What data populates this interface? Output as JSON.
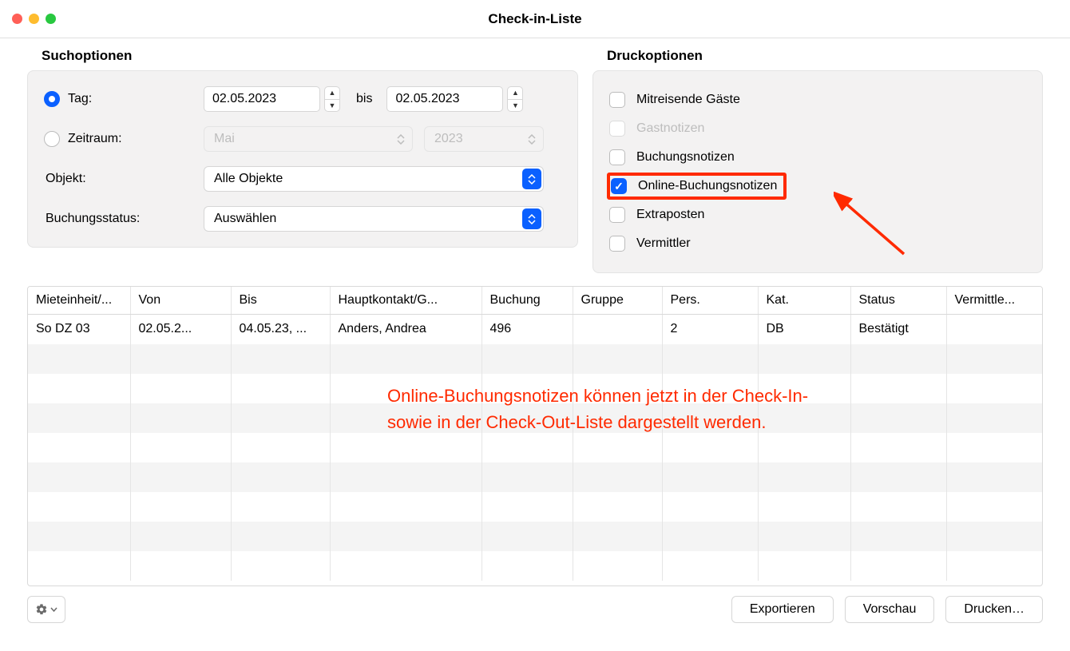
{
  "window_title": "Check-in-Liste",
  "search": {
    "section_title": "Suchoptionen",
    "tag_label": "Tag:",
    "zeitraum_label": "Zeitraum:",
    "date_from": "02.05.2023",
    "bis_label": "bis",
    "date_to": "02.05.2023",
    "month": "Mai",
    "year": "2023",
    "objekt_label": "Objekt:",
    "objekt_value": "Alle Objekte",
    "status_label": "Buchungsstatus:",
    "status_value": "Auswählen"
  },
  "print": {
    "section_title": "Druckoptionen",
    "mitreisende": "Mitreisende Gäste",
    "gastnotizen": "Gastnotizen",
    "buchungsnotizen": "Buchungsnotizen",
    "online_buchungsnotizen": "Online-Buchungsnotizen",
    "extraposten": "Extraposten",
    "vermittler": "Vermittler"
  },
  "table": {
    "headers": {
      "mieteinheit": "Mieteinheit/...",
      "von": "Von",
      "bis": "Bis",
      "hauptkontakt": "Hauptkontakt/G...",
      "buchung": "Buchung",
      "gruppe": "Gruppe",
      "pers": "Pers.",
      "kat": "Kat.",
      "status": "Status",
      "vermittler": "Vermittle..."
    },
    "rows": [
      {
        "mieteinheit": "So DZ 03",
        "von": "02.05.2...",
        "bis": "04.05.23, ...",
        "hauptkontakt": "Anders, Andrea",
        "buchung": "496",
        "gruppe": "",
        "pers": "2",
        "kat": "DB",
        "status": "Bestätigt",
        "vermittler": ""
      }
    ]
  },
  "annotation_text": "Online-Buchungsnotizen können jetzt in der Check-In-\nsowie in der Check-Out-Liste dargestellt werden.",
  "footer": {
    "export": "Exportieren",
    "preview": "Vorschau",
    "print": "Drucken…"
  }
}
